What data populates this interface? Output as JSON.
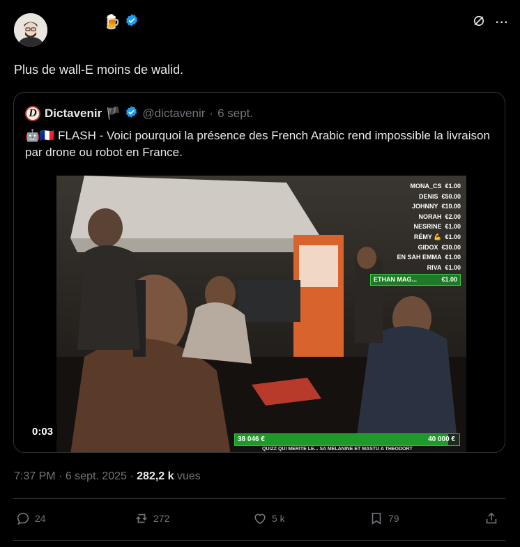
{
  "tweet": {
    "emoji": "🍺",
    "verified_icon": "verified-check-icon",
    "text": "Plus de wall-E moins de walid.",
    "time": "7:37 PM",
    "date": "6 sept. 2025",
    "views_count": "282,2 k",
    "views_label": "vues"
  },
  "header_actions": {
    "grok_icon": "grok-icon",
    "more_icon": "more-icon",
    "more_label": "···"
  },
  "quote": {
    "logo_letter": "D",
    "name": "Dictavenir",
    "flag": "🏴",
    "handle": "@dictavenir",
    "separator": "·",
    "date": "6 sept.",
    "text": "🤖🇫🇷 FLASH - Voici pourquoi la présence des French Arabic rend impossible la livraison par drone ou robot en France.",
    "video_duration": "0:03",
    "overlay": {
      "donors": [
        {
          "name": "MONA_CS",
          "amount": "€1.00"
        },
        {
          "name": "DENIS",
          "amount": "€50.00"
        },
        {
          "name": "JOHNNY",
          "amount": "€10.00"
        },
        {
          "name": "NORAH",
          "amount": "€2.00"
        },
        {
          "name": "NESRINE",
          "amount": "€1.00"
        },
        {
          "name": "RÉMY 💪",
          "amount": "€1.00"
        },
        {
          "name": "GIDOX",
          "amount": "€30.00"
        },
        {
          "name": "EN SAH EMMA",
          "amount": "€1.00"
        },
        {
          "name": "RIVA",
          "amount": "€1.00"
        },
        {
          "name": "ETHAN MAG...",
          "amount": "€1.00"
        }
      ],
      "progress_current": "38 046 €",
      "progress_goal": "40 000 €",
      "progress_fraction": 0.95,
      "ticker": "QUIZZ QUI MERITE LE... SA MELANINE ET MASTU A THEODORT"
    }
  },
  "actions": {
    "replies": "24",
    "reposts": "272",
    "likes": "5 k",
    "bookmarks": "79"
  }
}
